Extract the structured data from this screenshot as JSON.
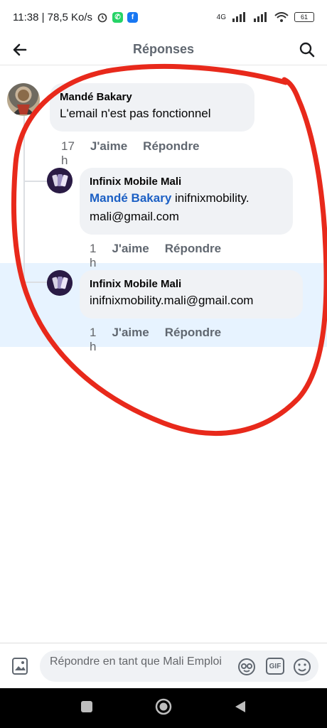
{
  "status_bar": {
    "time_speed": "11:38 | 78,5 Ko/s",
    "network": "4G",
    "battery": "61"
  },
  "header": {
    "title": "Réponses"
  },
  "comments": [
    {
      "author": "Mandé Bakary",
      "text": "L'email n'est pas fonctionnel",
      "time": "17 h",
      "like": "J'aime",
      "reply": "Répondre"
    },
    {
      "author": "Infinix Mobile Mali",
      "mention": "Mandé Bakary",
      "text_line1": " inifnixmobility.",
      "text_line2": "mali@gmail.com",
      "time": "1 h",
      "like": "J'aime",
      "reply": "Répondre"
    },
    {
      "author": "Infinix Mobile Mali",
      "text": "inifnixmobility.mali@gmail.com",
      "time": "1 h",
      "like": "J'aime",
      "reply": "Répondre"
    }
  ],
  "composer": {
    "placeholder": "Répondre en tant que Mali Emploi",
    "gif_label": "GIF"
  },
  "colors": {
    "annotation_red": "#e8291b",
    "mention_blue": "#1b5fc4",
    "highlight": "#e7f3ff"
  }
}
